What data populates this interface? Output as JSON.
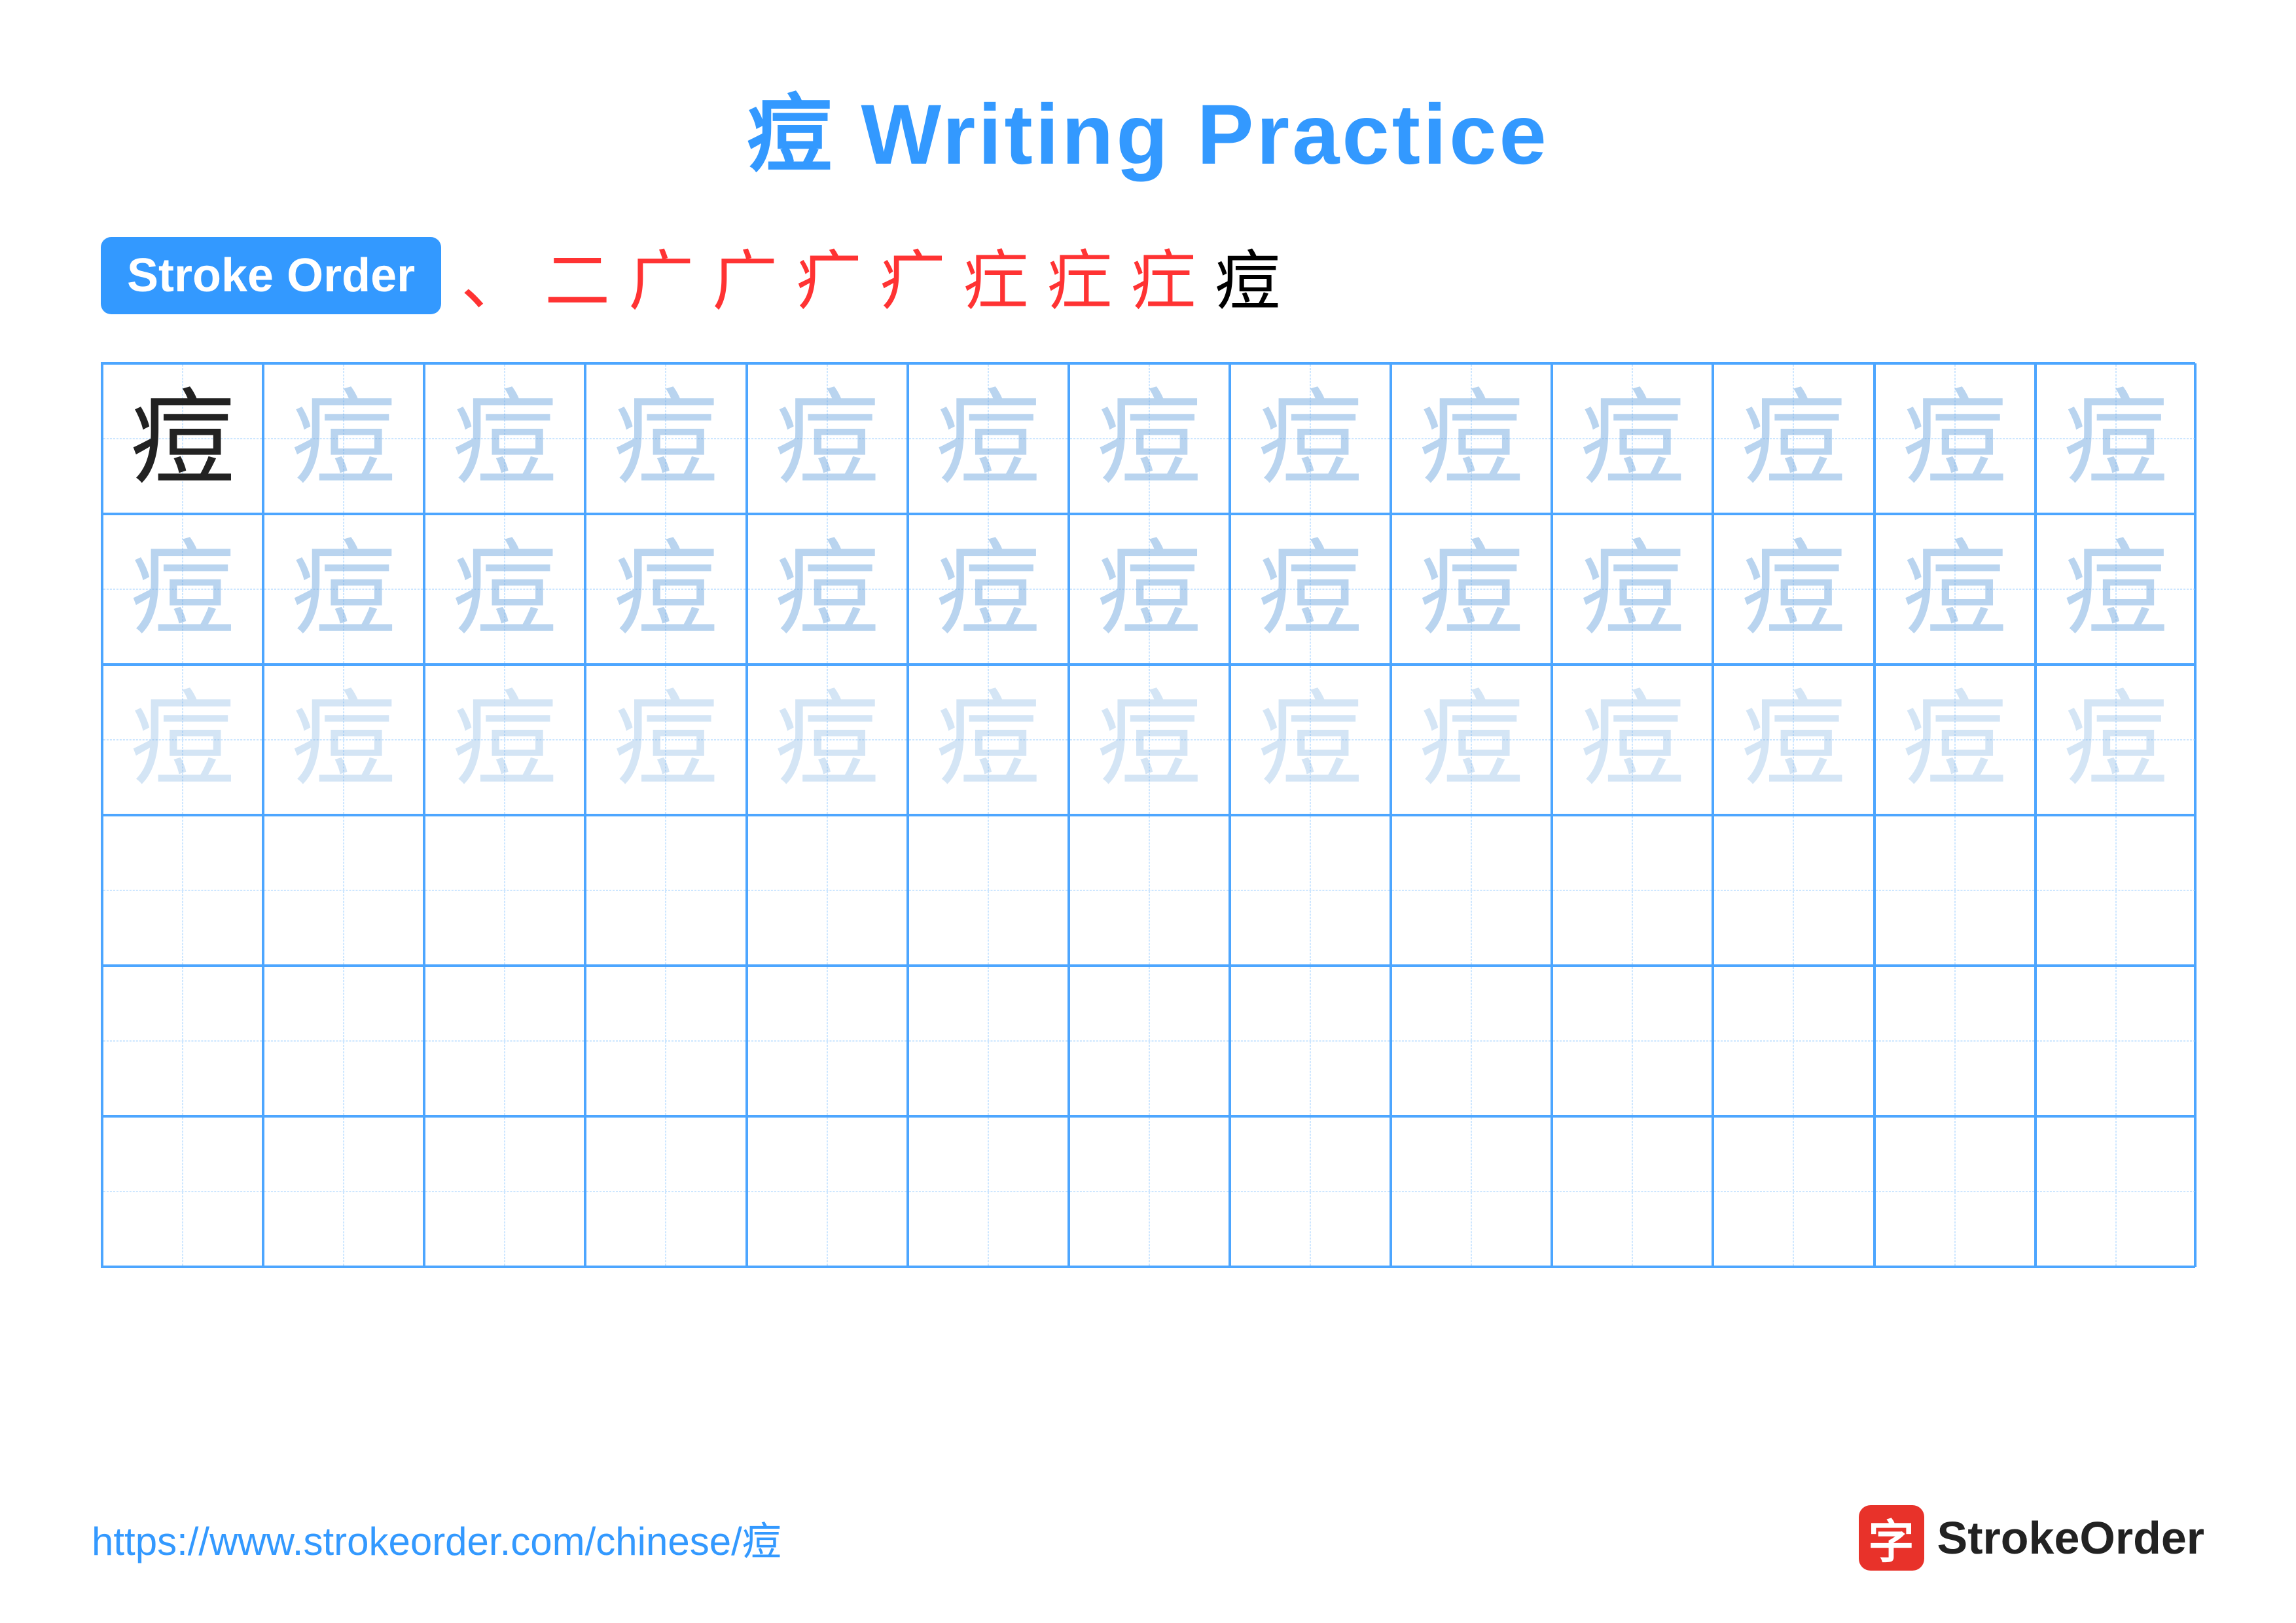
{
  "title": "痘 Writing Practice",
  "stroke_order_badge": "Stroke Order",
  "stroke_sequence": [
    "、",
    "二",
    "广",
    "广",
    "疒",
    "疒",
    "疘",
    "疘",
    "疘",
    "痘"
  ],
  "character": "痘",
  "rows": [
    {
      "type": "row1",
      "cells": 13
    },
    {
      "type": "row2",
      "cells": 13
    },
    {
      "type": "row3",
      "cells": 13
    },
    {
      "type": "empty",
      "cells": 13
    },
    {
      "type": "empty",
      "cells": 13
    },
    {
      "type": "empty",
      "cells": 13
    }
  ],
  "footer": {
    "url": "https://www.strokeorder.com/chinese/痘",
    "logo_char": "字",
    "logo_text": "StrokeOrder"
  }
}
